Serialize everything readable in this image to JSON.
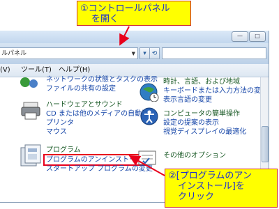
{
  "callout_top": {
    "line1": "①コントロールパネル",
    "line2": "を開く"
  },
  "callout_bottom": {
    "line1": "②[プログラムのアン",
    "line2": "インストール]を",
    "line3": "クリック"
  },
  "address": {
    "path": "ルパネル",
    "search_value": ""
  },
  "menu": {
    "view_fragment": "(V)",
    "tools": "ツール(T)",
    "help": "ヘルプ(H)"
  },
  "left_column": {
    "network_task": "ネットワークの状態とタスクの表示",
    "file_sharing": "ファイルの共有の設定",
    "hardware_title": "ハードウェアとサウンド",
    "cd_autoplay": "CD または他のメディアの自動再生",
    "printer": "プリンタ",
    "mouse": "マウス",
    "programs_title": "プログラム",
    "uninstall": "プログラムのアンインストール",
    "startup": "スタートアップ プログラムの変更"
  },
  "right_column": {
    "clock_title": "時計、言語、および地域",
    "keyboard": "キーボードまたは入力方法の変更",
    "display_lang": "表示言語の変更",
    "ease_title": "コンピュータの簡単操作",
    "suggest": "設定の提案の表示",
    "visual": "視覚ディスプレイの最適化",
    "other_options": "その他のオプション"
  },
  "window_buttons": {
    "minimize": "—",
    "maximize": "□"
  },
  "colors": {
    "callout_bg": "#ffff00",
    "callout_text": "#1c2fd0",
    "arrow": "#e8001c",
    "link": "#1545a8",
    "category": "#1a5a26"
  },
  "icons": [
    "arrow-pointer",
    "drop-arrow-icon",
    "refresh-icon",
    "network-icon",
    "globe-clock-icon",
    "printer-icon",
    "ease-of-access-icon",
    "programs-icon",
    "other-options-icon",
    "scroll-thumb"
  ]
}
